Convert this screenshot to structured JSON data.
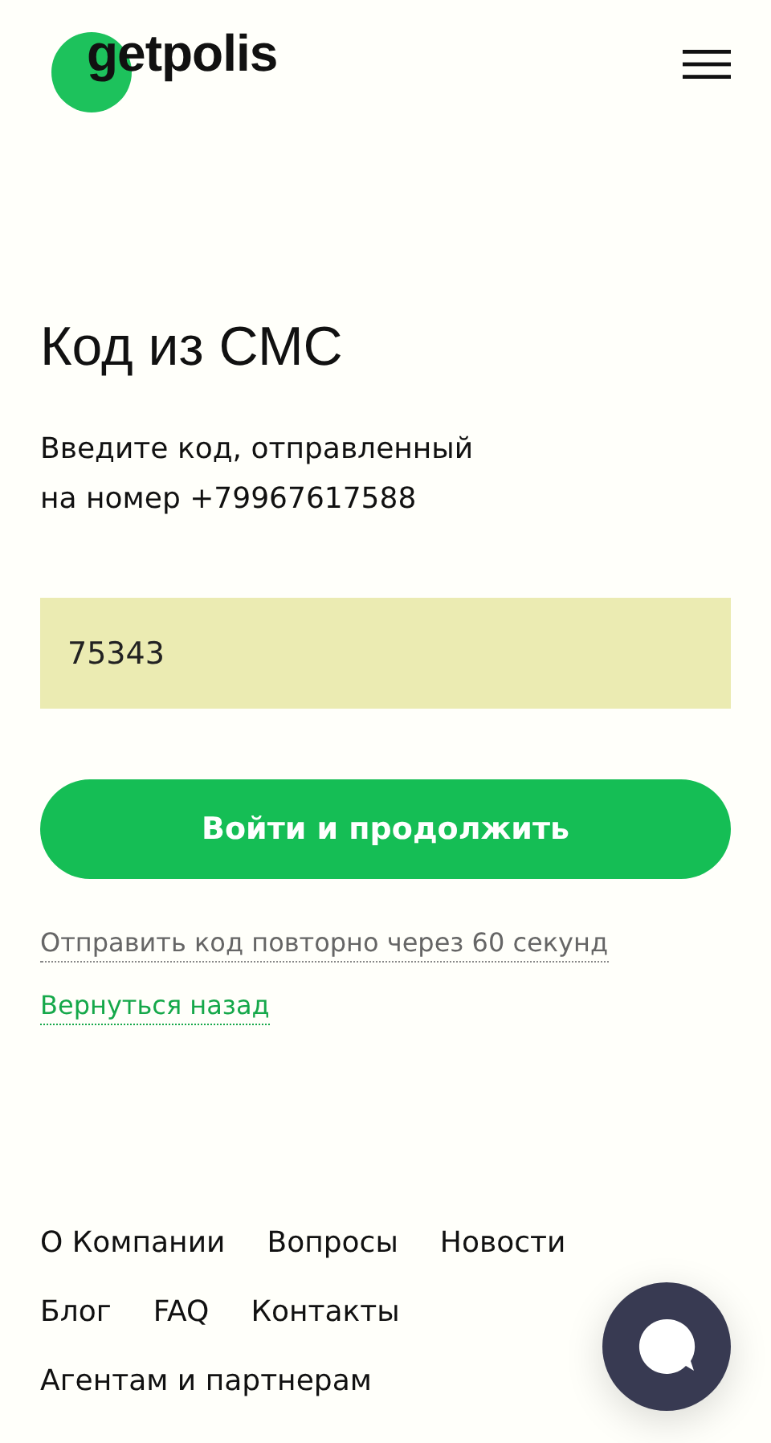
{
  "header": {
    "logo": "getpolis"
  },
  "title": "Код из СМС",
  "description_lines": [
    "Введите код, отправленный",
    "на номер +79967617588"
  ],
  "code_field": {
    "value": "75343"
  },
  "submit_button": "Войти и продолжить",
  "resend_link": {
    "label": "Отправить код повторно через 60 секунд",
    "disabled": true
  },
  "back_link": "Вернуться назад",
  "footer_rows": [
    [
      "О Компании",
      "Вопросы",
      "Новости"
    ],
    [
      "Блог",
      "FAQ",
      "Контакты"
    ],
    [
      "Агентам и партнерам"
    ]
  ]
}
